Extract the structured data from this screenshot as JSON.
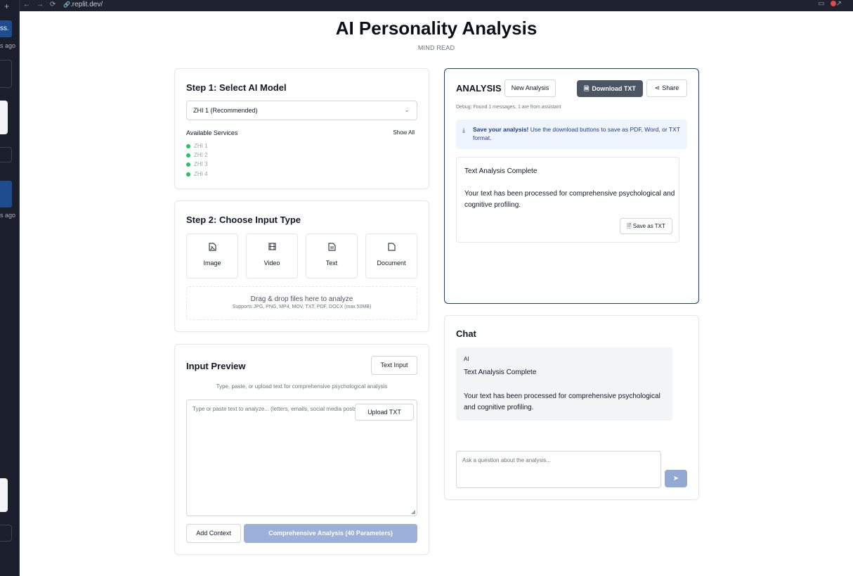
{
  "browser": {
    "url": ".replit.dev/",
    "nav_icons": "←→⟳",
    "link_icon": "🔗"
  },
  "side_panel": {
    "texts": [
      "ss.",
      "s ago",
      "s ago"
    ],
    "plus": "+"
  },
  "header": {
    "title": "AI Personality Analysis",
    "subtitle": "MIND READ"
  },
  "step1": {
    "title": "Step 1: Select AI Model",
    "selected_model": "ZHI 1 (Recommended)",
    "services_label": "Available Services",
    "show_all": "Show All",
    "services": [
      "ZHI 1",
      "ZHI 2",
      "ZHI 3",
      "ZHI 4"
    ],
    "status_color": "#22c55e"
  },
  "step2": {
    "title": "Step 2: Choose Input Type",
    "types": [
      {
        "label": "Image",
        "icon": "image-file-icon"
      },
      {
        "label": "Video",
        "icon": "film-icon"
      },
      {
        "label": "Text",
        "icon": "text-file-icon"
      },
      {
        "label": "Document",
        "icon": "document-icon"
      }
    ],
    "dropzone_title": "Drag & drop files here to analyze",
    "dropzone_sub": "Supports JPG, PNG, MP4, MOV, TXT, PDF, DOCX (max 50MB)"
  },
  "input_preview": {
    "title": "Input Preview",
    "text_input_button": "Text Input",
    "hint": "Type, paste, or upload text for comprehensive psychological analysis",
    "textarea_placeholder": "Type or paste text to analyze... (letters, emails, social media posts, etc.)",
    "upload_button": "Upload TXT",
    "add_context_button": "Add Context",
    "analyze_button": "Comprehensive Analysis (40 Parameters)"
  },
  "analysis": {
    "title": "ANALYSIS",
    "new_button": "New Analysis",
    "download_button": "Download TXT",
    "share_button": "Share",
    "debug": "Debug: Found 1 messages, 1 are from assistant",
    "save_notice_bold": "Save your analysis!",
    "save_notice_text": " Use the download buttons to save as PDF, Word, or TXT format.",
    "result_heading": "Text Analysis Complete",
    "result_body": "Your text has been processed for comprehensive psychological and cognitive profiling.",
    "save_txt_button": "Save as TXT"
  },
  "chat": {
    "title": "Chat",
    "sender": "AI",
    "message_heading": "Text Analysis Complete",
    "message_body": "Your text has been processed for comprehensive psychological and cognitive profiling.",
    "input_placeholder": "Ask a question about the analysis..."
  },
  "colors": {
    "accent_blue": "#1e3a8a",
    "primary_disabled": "#9db0d9",
    "dark_button": "#4b5563"
  }
}
